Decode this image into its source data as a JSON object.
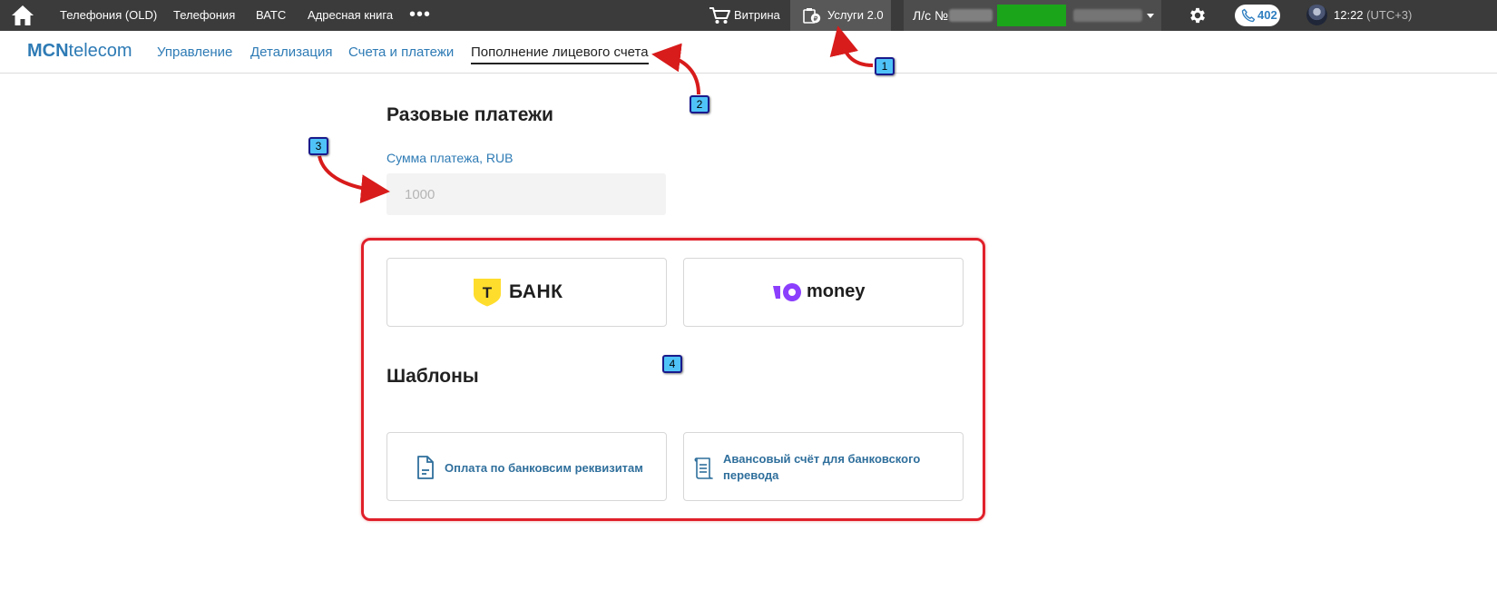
{
  "topbar": {
    "nav": [
      "Телефония (OLD)",
      "Телефония",
      "ВАТС",
      "Адресная книга"
    ],
    "more": "•••",
    "showcase": "Витрина",
    "services": "Услуги 2.0",
    "account_label": "Л/с №",
    "phone_count": "402",
    "time": "12:22",
    "timezone": "(UTC+3)"
  },
  "subnav": {
    "brand_bold": "MCN",
    "brand_rest": "telecom",
    "items": [
      "Управление",
      "Детализация",
      "Счета и платежи",
      "Пополнение лицевого счета"
    ],
    "active_index": 3
  },
  "main": {
    "title": "Разовые платежи",
    "amount_label": "Сумма платежа, RUB",
    "amount_placeholder": "1000",
    "tbank_text": "БАНК",
    "tbank_letter": "T",
    "ymoney_text": "money",
    "templates_title": "Шаблоны",
    "templates": [
      "Оплата по банковсим реквизитам",
      "Авансовый счёт для банковского перевода"
    ]
  },
  "markers": [
    "1",
    "2",
    "3",
    "4"
  ],
  "colors": {
    "topbar_bg": "#3b3b3b",
    "link_blue": "#2e7bb5",
    "highlight_red": "#e0202a",
    "tbank_yellow": "#ffdd2d",
    "ymoney_purple": "#8b3ffd",
    "account_green": "#1aa51a"
  }
}
